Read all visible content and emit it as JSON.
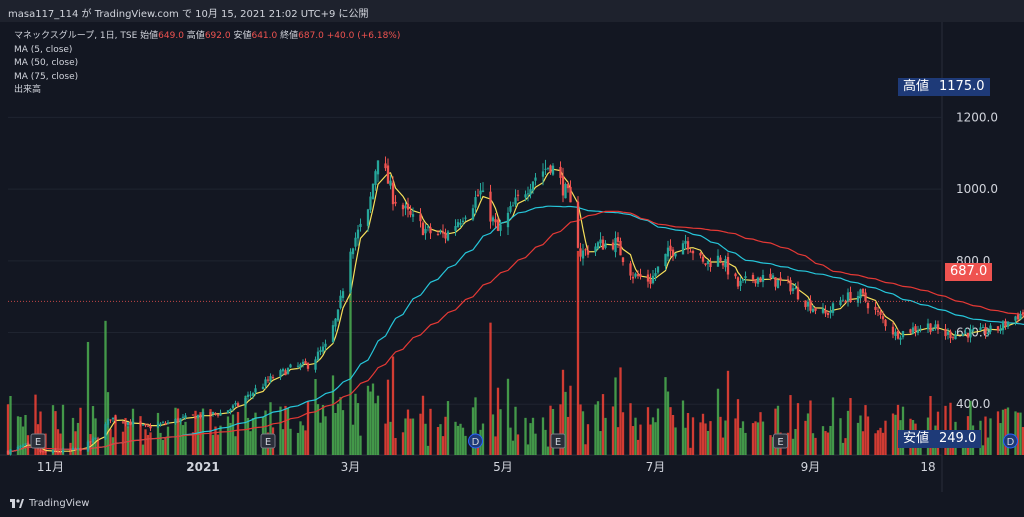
{
  "header": {
    "publish_line": "masa117_114 が TradingView.com で 10月 15, 2021 21:02 UTC+9 に公開"
  },
  "legend": {
    "symbol_line": "マネックスグループ, 1日, TSE",
    "open_label": "始値",
    "open_value": "649.0",
    "high_label": "高値",
    "high_value": "692.0",
    "low_label": "安値",
    "low_value": "641.0",
    "close_label": "終値",
    "close_value": "687.0",
    "change_value": "+40.0 (+6.18%)",
    "ma5": "MA (5, close)",
    "ma50": "MA (50, close)",
    "ma75": "MA (75, close)",
    "volume": "出来高"
  },
  "tags": {
    "high_label": "高値",
    "high_value": "1175.0",
    "low_label": "安値",
    "low_value": "249.0",
    "last_value": "687.0"
  },
  "footer": {
    "brand": "TradingView"
  },
  "colors": {
    "up": "#26a69a",
    "down": "#ef5350",
    "ma5": "#f7e05b",
    "ma50": "#26c6da",
    "ma75": "#e53935",
    "vol_up": "#4caf50",
    "vol_down": "#f44336",
    "tag_bg": "#1e3a78",
    "last_bg": "#ef5350"
  },
  "chart_data": {
    "type": "candlestick",
    "y_ticks": [
      {
        "value": 400,
        "label": "400.0"
      },
      {
        "value": 600,
        "label": "600.0"
      },
      {
        "value": 800,
        "label": "800.0"
      },
      {
        "value": 1000,
        "label": "1000.0"
      },
      {
        "value": 1200,
        "label": "1200.0"
      }
    ],
    "ylim": [
      250,
      1310
    ],
    "x_labels": [
      {
        "label": "11月",
        "bold": false,
        "date": "2020-11-01"
      },
      {
        "label": "2021",
        "bold": true,
        "date": "2021-01-01"
      },
      {
        "label": "3月",
        "bold": false,
        "date": "2021-03-01"
      },
      {
        "label": "5月",
        "bold": false,
        "date": "2021-05-01"
      },
      {
        "label": "7月",
        "bold": false,
        "date": "2021-07-01"
      },
      {
        "label": "9月",
        "bold": false,
        "date": "2021-09-01"
      },
      {
        "label": "18",
        "bold": false,
        "date": "2021-10-18"
      }
    ],
    "price_path": [
      [
        "2020-10-15",
        268
      ],
      [
        "2020-10-22",
        285
      ],
      [
        "2020-10-29",
        265
      ],
      [
        "2020-11-06",
        268
      ],
      [
        "2020-11-13",
        275
      ],
      [
        "2020-11-20",
        308
      ],
      [
        "2020-11-25",
        362
      ],
      [
        "2020-12-02",
        350
      ],
      [
        "2020-12-09",
        335
      ],
      [
        "2020-12-16",
        345
      ],
      [
        "2020-12-23",
        358
      ],
      [
        "2020-12-30",
        368
      ],
      [
        "2021-01-08",
        375
      ],
      [
        "2021-01-15",
        398
      ],
      [
        "2021-01-22",
        440
      ],
      [
        "2021-01-29",
        475
      ],
      [
        "2021-02-05",
        500
      ],
      [
        "2021-02-12",
        510
      ],
      [
        "2021-02-19",
        560
      ],
      [
        "2021-02-24",
        650
      ],
      [
        "2021-03-01",
        840
      ],
      [
        "2021-03-08",
        930
      ],
      [
        "2021-03-12",
        1100
      ],
      [
        "2021-03-18",
        980
      ],
      [
        "2021-03-25",
        920
      ],
      [
        "2021-04-01",
        880
      ],
      [
        "2021-04-08",
        870
      ],
      [
        "2021-04-15",
        930
      ],
      [
        "2021-04-22",
        990
      ],
      [
        "2021-04-29",
        880
      ],
      [
        "2021-05-06",
        960
      ],
      [
        "2021-05-13",
        1030
      ],
      [
        "2021-05-20",
        1070
      ],
      [
        "2021-05-27",
        980
      ],
      [
        "2021-06-01",
        820
      ],
      [
        "2021-06-08",
        845
      ],
      [
        "2021-06-15",
        850
      ],
      [
        "2021-06-22",
        760
      ],
      [
        "2021-06-29",
        745
      ],
      [
        "2021-07-06",
        820
      ],
      [
        "2021-07-13",
        860
      ],
      [
        "2021-07-20",
        790
      ],
      [
        "2021-07-27",
        810
      ],
      [
        "2021-08-03",
        730
      ],
      [
        "2021-08-10",
        755
      ],
      [
        "2021-08-17",
        745
      ],
      [
        "2021-08-24",
        730
      ],
      [
        "2021-08-31",
        680
      ],
      [
        "2021-09-07",
        650
      ],
      [
        "2021-09-14",
        695
      ],
      [
        "2021-09-21",
        705
      ],
      [
        "2021-09-28",
        650
      ],
      [
        "2021-10-05",
        595
      ],
      [
        "2021-10-12",
        610
      ],
      [
        "2021-10-18",
        620
      ],
      [
        "2021-10-25",
        595
      ],
      [
        "2021-11-01",
        598
      ],
      [
        "2021-11-08",
        600
      ],
      [
        "2021-11-15",
        610
      ],
      [
        "2021-11-22",
        645
      ],
      [
        "2021-11-29",
        665
      ],
      [
        "2021-12-03",
        687
      ]
    ],
    "events": [
      {
        "date": "2020-10-27",
        "label": "E"
      },
      {
        "date": "2021-01-27",
        "label": "E"
      },
      {
        "date": "2021-04-20",
        "label": "D"
      },
      {
        "date": "2021-05-23",
        "label": "E"
      },
      {
        "date": "2021-08-20",
        "label": "E"
      },
      {
        "date": "2021-11-20",
        "label": "D"
      }
    ],
    "last_price": 687.0,
    "high": 1175.0,
    "low": 249.0
  }
}
